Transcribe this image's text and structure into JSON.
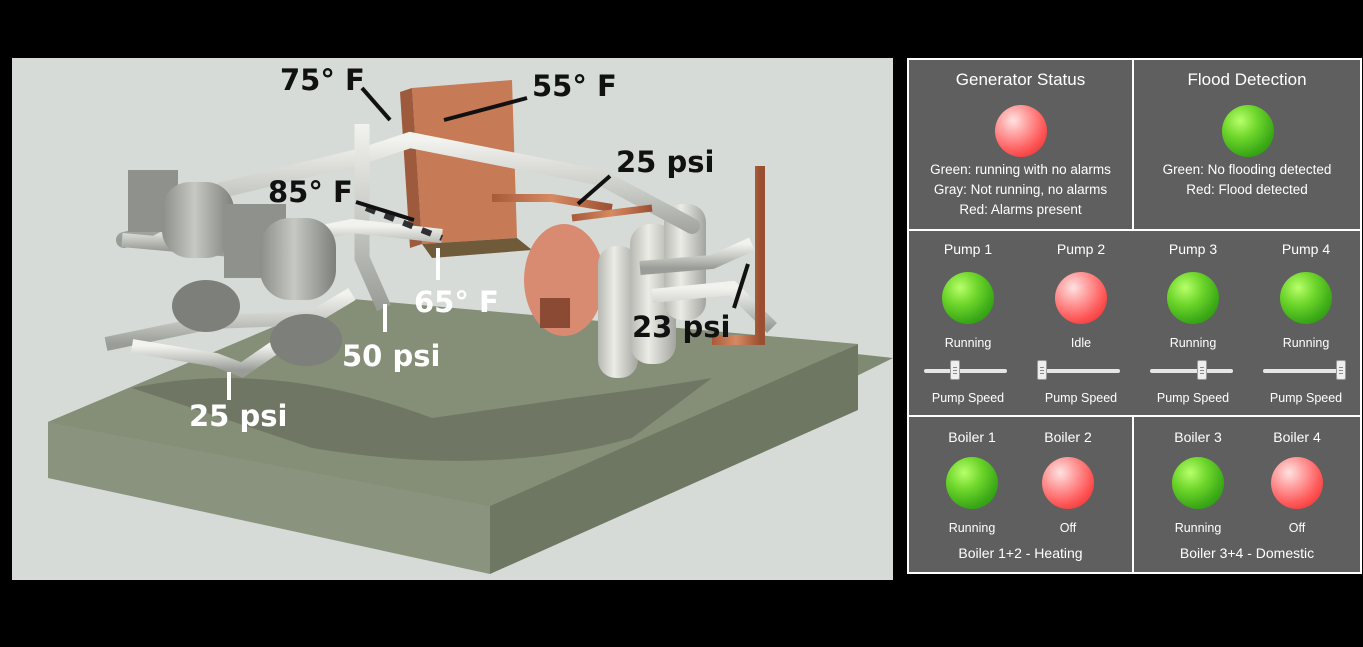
{
  "callouts": {
    "t75": "75° F",
    "t55": "55° F",
    "p25a": "25 psi",
    "t85": "85° F",
    "t65": "65° F",
    "p23": "23 psi",
    "p50": "50 psi",
    "p25b": "25 psi"
  },
  "generator": {
    "title": "Generator Status",
    "state": "red",
    "legend": [
      "Green: running with no alarms",
      "Gray: Not running, no alarms",
      "Red: Alarms present"
    ]
  },
  "flood": {
    "title": "Flood Detection",
    "state": "green",
    "legend": [
      "Green: No flooding detected",
      "Red: Flood detected"
    ]
  },
  "pumps": [
    {
      "name": "Pump 1",
      "status": "Running",
      "color": "green",
      "speed_label": "Pump Speed",
      "speed": 0.35
    },
    {
      "name": "Pump 2",
      "status": "Idle",
      "color": "red",
      "speed_label": "Pump Speed",
      "speed": 0.0
    },
    {
      "name": "Pump 3",
      "status": "Running",
      "color": "green",
      "speed_label": "Pump Speed",
      "speed": 0.65
    },
    {
      "name": "Pump 4",
      "status": "Running",
      "color": "green",
      "speed_label": "Pump Speed",
      "speed": 1.0
    }
  ],
  "boilers": [
    {
      "name": "Boiler 1",
      "status": "Running",
      "color": "green"
    },
    {
      "name": "Boiler 2",
      "status": "Off",
      "color": "red"
    },
    {
      "name": "Boiler 3",
      "status": "Running",
      "color": "green"
    },
    {
      "name": "Boiler 4",
      "status": "Off",
      "color": "red"
    }
  ],
  "boiler_groups": [
    "Boiler 1+2 - Heating",
    "Boiler 3+4 - Domestic"
  ],
  "colors": {
    "panel_bg": "#5f5f5f",
    "status_green": "#3aa817",
    "status_red": "#ff5a5a"
  }
}
